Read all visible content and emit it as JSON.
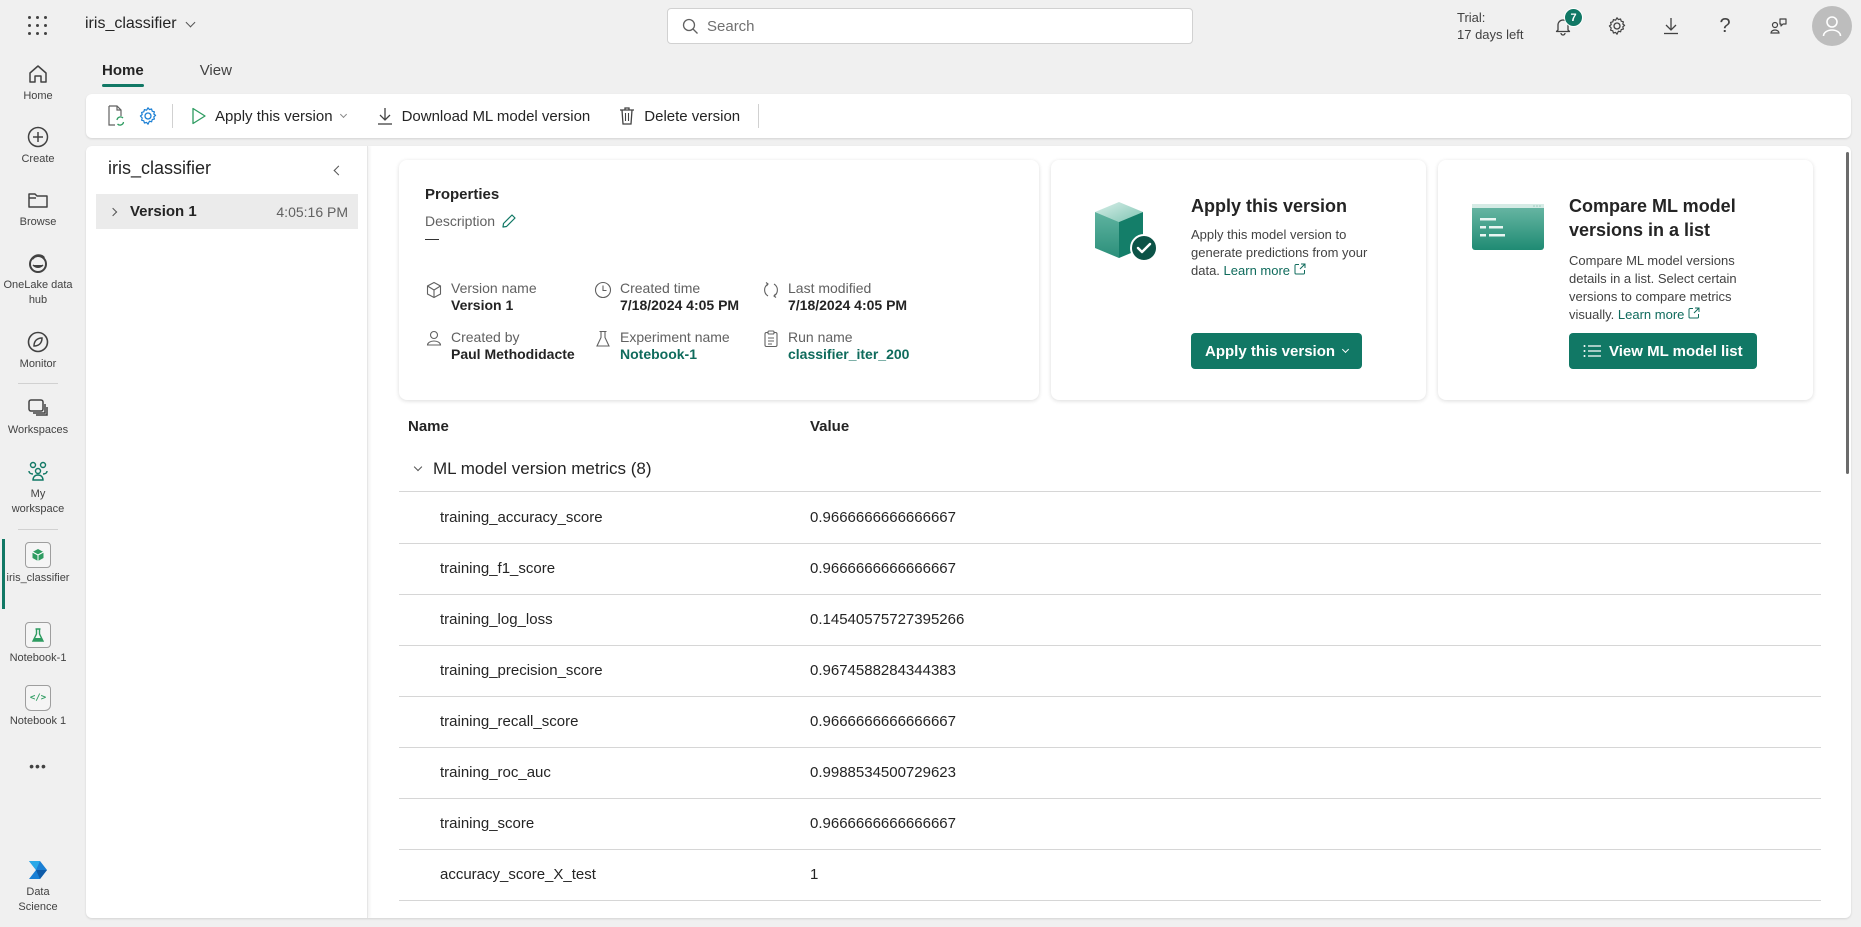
{
  "app": {
    "title": "iris_classifier",
    "search_placeholder": "Search",
    "trial_line1": "Trial:",
    "trial_line2": "17 days left",
    "notification_count": "7"
  },
  "rail": {
    "items": [
      {
        "label": "Home",
        "icon": "home-icon"
      },
      {
        "label": "Create",
        "icon": "plus-circle-icon"
      },
      {
        "label": "Browse",
        "icon": "folder-icon"
      },
      {
        "label": "OneLake data hub",
        "icon": "onelake-icon"
      },
      {
        "label": "Monitor",
        "icon": "monitor-icon"
      },
      {
        "label": "Workspaces",
        "icon": "workspaces-icon"
      },
      {
        "label": "My workspace",
        "icon": "my-workspace-icon"
      },
      {
        "label": "iris_classifier",
        "icon": "ml-model-icon",
        "active": true
      },
      {
        "label": "Notebook-1",
        "icon": "experiment-icon"
      },
      {
        "label": "Notebook 1",
        "icon": "notebook-icon"
      }
    ],
    "more": "•••",
    "bottom": {
      "label": "Data Science",
      "icon": "data-science-icon"
    }
  },
  "tabs": [
    {
      "label": "Home",
      "active": true
    },
    {
      "label": "View",
      "active": false
    }
  ],
  "toolbar": {
    "apply_label": "Apply this version",
    "download_label": "Download ML model version",
    "delete_label": "Delete version"
  },
  "tree": {
    "title": "iris_classifier",
    "items": [
      {
        "name": "Version 1",
        "time": "4:05:16 PM"
      }
    ]
  },
  "properties": {
    "heading": "Properties",
    "description_label": "Description",
    "description_value": "—",
    "fields": [
      {
        "label": "Version name",
        "value": "Version 1",
        "link": false,
        "icon": "cube-outline-icon"
      },
      {
        "label": "Created time",
        "value": "7/18/2024 4:05 PM",
        "link": false,
        "icon": "clock-icon"
      },
      {
        "label": "Last modified",
        "value": "7/18/2024 4:05 PM",
        "link": false,
        "icon": "refresh-icon"
      },
      {
        "label": "Created by",
        "value": "Paul Methodidacte",
        "link": false,
        "icon": "person-icon"
      },
      {
        "label": "Experiment name",
        "value": "Notebook-1",
        "link": true,
        "icon": "beaker-icon"
      },
      {
        "label": "Run name",
        "value": "classifier_iter_200",
        "link": true,
        "icon": "clipboard-icon"
      }
    ]
  },
  "apply_card": {
    "title": "Apply this version",
    "text": "Apply this model version to generate predictions from your data.",
    "learn_more": "Learn more",
    "button": "Apply this version"
  },
  "compare_card": {
    "title": "Compare ML model versions in a list",
    "text": "Compare ML model versions details in a list. Select certain versions to compare metrics visually.",
    "learn_more": "Learn more",
    "button": "View ML model list"
  },
  "metrics": {
    "col_name": "Name",
    "col_value": "Value",
    "group_label": "ML model version metrics (8)",
    "rows": [
      {
        "name": "training_accuracy_score",
        "value": "0.9666666666666667"
      },
      {
        "name": "training_f1_score",
        "value": "0.9666666666666667"
      },
      {
        "name": "training_log_loss",
        "value": "0.14540575727395266"
      },
      {
        "name": "training_precision_score",
        "value": "0.9674588284344383"
      },
      {
        "name": "training_recall_score",
        "value": "0.9666666666666667"
      },
      {
        "name": "training_roc_auc",
        "value": "0.9988534500729623"
      },
      {
        "name": "training_score",
        "value": "0.9666666666666667"
      },
      {
        "name": "accuracy_score_X_test",
        "value": "1"
      }
    ]
  },
  "colors": {
    "accent": "#117865",
    "link": "#0f6b5c"
  }
}
